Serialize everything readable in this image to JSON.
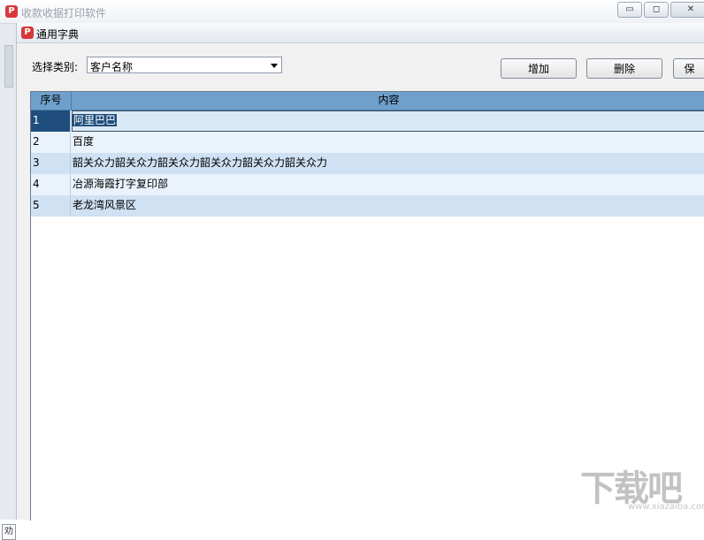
{
  "outer_window": {
    "title": "收款收据打印软件",
    "app_icon": "P",
    "controls": {
      "minimize": "▭",
      "restore": "◻",
      "close": "✕"
    },
    "bottom_label": "劝"
  },
  "dialog": {
    "title": "通用字典",
    "icon": "P",
    "category_label": "选择类别:",
    "category_value": "客户名称",
    "buttons": {
      "add": "增加",
      "delete": "删除",
      "save": "保"
    }
  },
  "grid": {
    "columns": {
      "seq": "序号",
      "content": "内容"
    },
    "rows": [
      {
        "seq": "1",
        "content": "阿里巴巴"
      },
      {
        "seq": "2",
        "content": "百度"
      },
      {
        "seq": "3",
        "content": "韶关众力韶关众力韶关众力韶关众力韶关众力韶关众力"
      },
      {
        "seq": "4",
        "content": "冶源海霞打字复印部"
      },
      {
        "seq": "5",
        "content": "老龙湾风景区"
      }
    ],
    "selected_row": "1"
  },
  "watermark": {
    "text": "下载吧",
    "url": "www.xiazaiba.com"
  }
}
